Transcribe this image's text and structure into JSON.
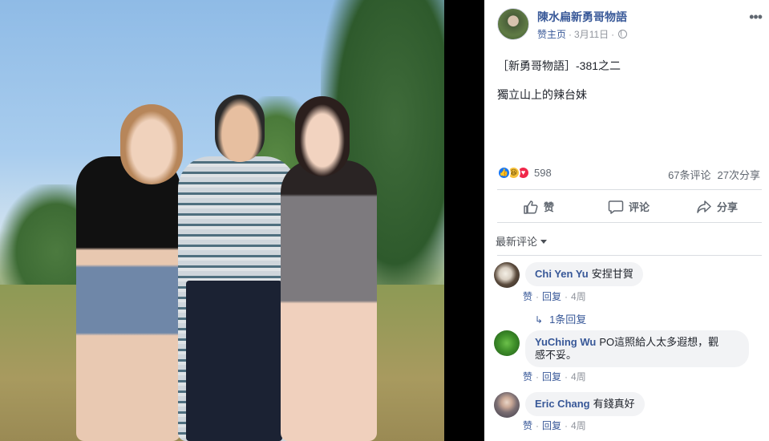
{
  "post": {
    "page_name": "陳水扁新勇哥物語",
    "like_page": "赞主页",
    "date": "3月11日",
    "text_line1": "［新勇哥物語］-381之二",
    "text_line2": "獨立山上的辣台妹"
  },
  "stats": {
    "reaction_count": "598",
    "comment_count": "67条评论",
    "share_count": "27次分享"
  },
  "actions": {
    "like": "赞",
    "comment": "评论",
    "share": "分享"
  },
  "sort_label": "最新评论",
  "comments": [
    {
      "name": "Chi Yen Yu",
      "text": "安捏甘賀",
      "like": "赞",
      "reply": "回复",
      "time": "4周",
      "replies": "1条回复"
    },
    {
      "name": "YuChing Wu",
      "text_line1": "PO這照給人太多遐想，觀",
      "text_line2": "感不妥。",
      "like": "赞",
      "reply": "回复",
      "time": "4周"
    },
    {
      "name": "Eric Chang",
      "text": "有錢真好",
      "like": "赞",
      "reply": "回复",
      "time": "4周"
    }
  ],
  "colors": {
    "link": "#385898",
    "muted": "#90949c",
    "like_blue": "#1877f2"
  }
}
